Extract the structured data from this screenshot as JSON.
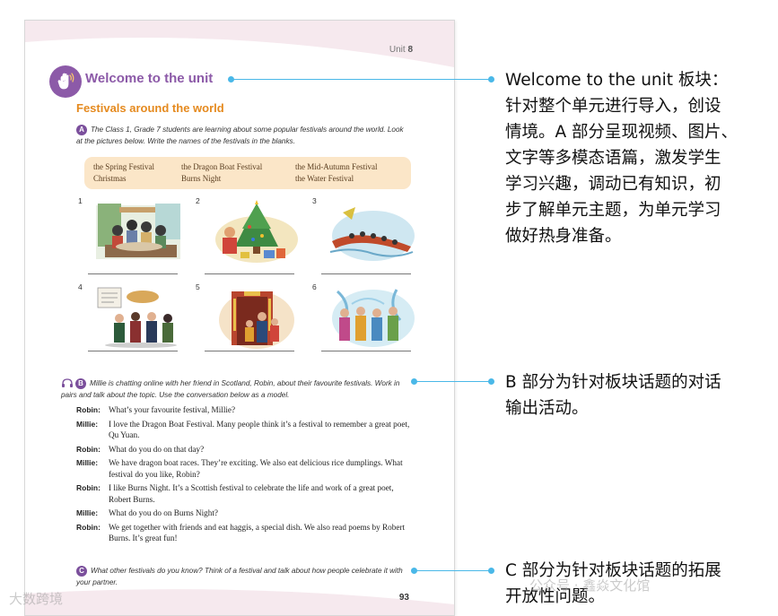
{
  "page": {
    "unit_label": "Unit",
    "unit_number": "8",
    "welcome_title": "Welcome to the unit",
    "section_title": "Festivals around the world",
    "page_number": "93"
  },
  "part_a": {
    "letter": "A",
    "instruction": "The Class 1, Grade 7 students are learning about some popular festivals around the world. Look at the pictures below. Write the names of the festivals in the blanks.",
    "words": [
      "the Spring Festival",
      "the Dragon Boat Festival",
      "the Mid-Autumn Festival",
      "Christmas",
      "Burns Night",
      "the Water Festival"
    ],
    "picture_numbers": [
      "1",
      "2",
      "3",
      "4",
      "5",
      "6"
    ]
  },
  "part_b": {
    "letter": "B",
    "instruction": "Millie is chatting online with her friend in Scotland, Robin, about their favourite festivals. Work in pairs and talk about the topic. Use the conversation below as a model.",
    "dialogue": [
      {
        "speaker": "Robin:",
        "line": "What’s your favourite festival, Millie?"
      },
      {
        "speaker": "Millie:",
        "line": "I love the Dragon Boat Festival. Many people think it’s a festival to remember a great poet, Qu Yuan."
      },
      {
        "speaker": "Robin:",
        "line": "What do you do on that day?"
      },
      {
        "speaker": "Millie:",
        "line": "We have dragon boat races. They’re exciting. We also eat delicious rice dumplings. What festival do you like, Robin?"
      },
      {
        "speaker": "Robin:",
        "line": "I like Burns Night. It’s a Scottish festival to celebrate the life and work of a great poet, Robert Burns."
      },
      {
        "speaker": "Millie:",
        "line": "What do you do on Burns Night?"
      },
      {
        "speaker": "Robin:",
        "line": "We get together with friends and eat haggis, a special dish. We also read poems by Robert Burns. It’s great fun!"
      }
    ]
  },
  "part_c": {
    "letter": "C",
    "instruction": "What other festivals do you know? Think of a festival and talk about how people celebrate it with your partner."
  },
  "annotations": {
    "note_welcome": [
      "Welcome to the unit 板块：",
      "针对整个单元进行导入，创设",
      "情境。A 部分呈现视频、图片、",
      "文字等多模态语篇，激发学生",
      "学习兴趣，调动已有知识，初",
      "步了解单元主题，为单元学习",
      "做好热身准备。"
    ],
    "note_b": [
      "B 部分为针对板块话题的对话",
      "输出活动。"
    ],
    "note_c": [
      "C 部分为针对板块话题的拓展",
      "开放性问题。"
    ]
  },
  "watermarks": {
    "left": "大数跨境",
    "right": "公众号 · 鑫焱文化馆"
  },
  "colors": {
    "accent_purple": "#8c5aa8",
    "title_orange": "#e58a1f",
    "word_box": "#fbe6c8",
    "connector_blue": "#4ab8e8"
  }
}
